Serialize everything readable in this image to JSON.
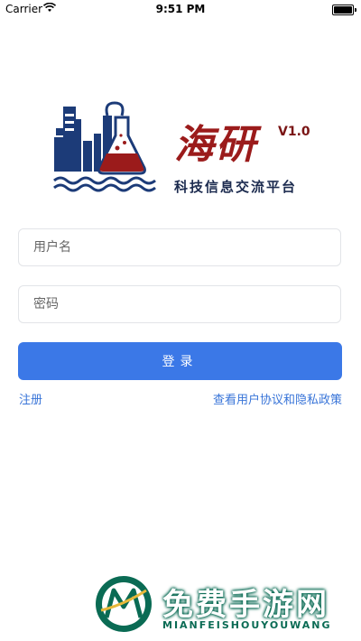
{
  "status_bar": {
    "carrier": "Carrier",
    "time": "9:51 PM"
  },
  "logo": {
    "title": "海研",
    "version": "V1.0",
    "slogan": "科技信息交流平台"
  },
  "form": {
    "username_placeholder": "用户名",
    "password_placeholder": "密码",
    "login_label": "登录"
  },
  "links": {
    "register": "注册",
    "policy": "查看用户协议和隐私政策"
  },
  "watermark": {
    "title": "免费手游网",
    "subtitle": "MIANFEISHOUYOUWANG"
  },
  "colors": {
    "primary": "#3b78e7",
    "link": "#3874d8",
    "brand_red": "#9b1b1b",
    "brand_navy": "#1c2b4f",
    "watermark_green": "#0a6b54"
  }
}
